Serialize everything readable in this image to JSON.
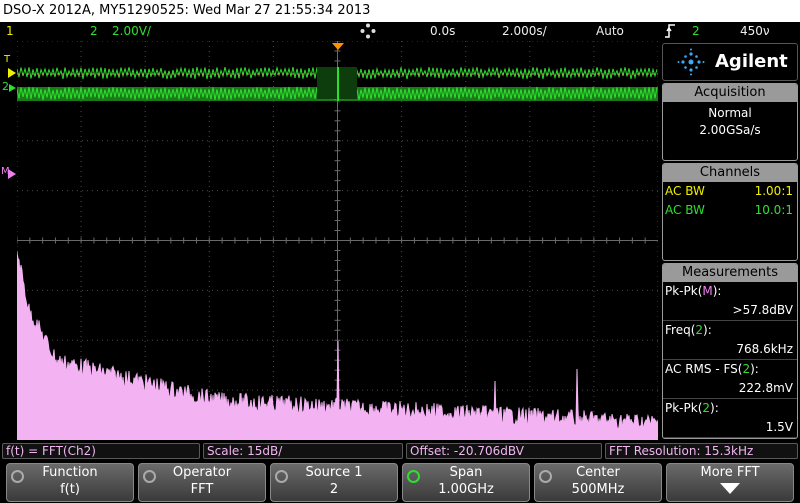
{
  "title_bar": {
    "text": "DSO-X 2012A, MY51290525: Wed Mar 27 21:55:34 2013"
  },
  "status_bar": {
    "ch1_label": "1",
    "ch2_label": "2",
    "ch2_scale": "2.00V/",
    "run_state_icon": "stop-run-icon",
    "time_delay": "0.0s",
    "time_scale": "2.000s/",
    "trigger_mode": "Auto",
    "trigger_icon": "trigger-edge-icon",
    "trigger_source": "2",
    "trigger_level": "450ν"
  },
  "brand": {
    "name": "Agilent"
  },
  "acquisition": {
    "title": "Acquisition",
    "mode": "Normal",
    "rate": "2.00GSa/s"
  },
  "channels": {
    "title": "Channels",
    "rows": [
      {
        "label": "AC BW",
        "value": "1.00:1",
        "color": "#f0f000"
      },
      {
        "label": "AC BW",
        "value": "10.0:1",
        "color": "#2ee02e"
      }
    ]
  },
  "measurements": {
    "title": "Measurements",
    "items": [
      {
        "label_prefix": "Pk-Pk(",
        "label_src": "M",
        "label_suffix": "):",
        "src_color": "#f080f0",
        "value": ">57.8dBV"
      },
      {
        "label_prefix": "Freq(",
        "label_src": "2",
        "label_suffix": "):",
        "src_color": "#2ee02e",
        "value": "768.6kHz"
      },
      {
        "label_prefix": "AC RMS - FS(",
        "label_src": "2",
        "label_suffix": "):",
        "src_color": "#2ee02e",
        "value": "222.8mV"
      },
      {
        "label_prefix": "Pk-Pk(",
        "label_src": "2",
        "label_suffix": "):",
        "src_color": "#2ee02e",
        "value": "1.5V"
      }
    ]
  },
  "info_bar": {
    "function": "f(t) = FFT(Ch2)",
    "scale": "Scale: 15dB/",
    "offset": "Offset: -20.706dBV",
    "resolution": "FFT Resolution: 15.3kHz"
  },
  "softkeys": [
    {
      "label": "Function",
      "value": "f(t)",
      "has_knob": true,
      "knob_active": false
    },
    {
      "label": "Operator",
      "value": "FFT",
      "has_knob": true,
      "knob_active": false
    },
    {
      "label": "Source 1",
      "value": "2",
      "has_knob": true,
      "knob_active": false
    },
    {
      "label": "Span",
      "value": "1.00GHz",
      "has_knob": true,
      "knob_active": true
    },
    {
      "label": "Center",
      "value": "500MHz",
      "has_knob": true,
      "knob_active": false
    },
    {
      "label": "More FFT",
      "value": "",
      "has_knob": false,
      "knob_active": false
    }
  ],
  "markers": {
    "ch1": "1",
    "ch2": "2",
    "math": "M",
    "trigger": "T"
  },
  "colors": {
    "ch1": "#f0f000",
    "ch2": "#2ee02e",
    "math": "#f080f0",
    "grid": "#4a4a4a",
    "trigger_marker": "#ff9000"
  }
}
